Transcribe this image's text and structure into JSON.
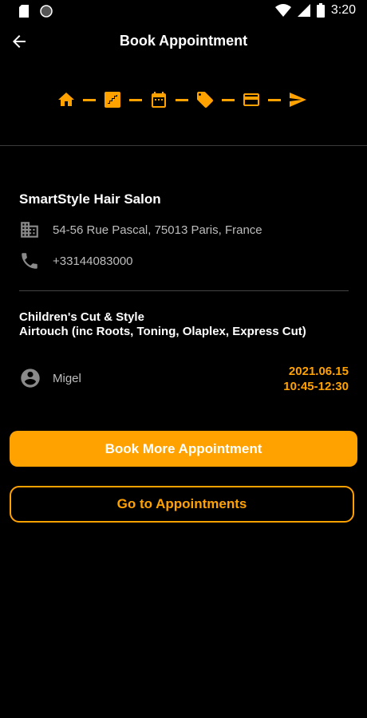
{
  "status_bar": {
    "time": "3:20"
  },
  "header": {
    "title": "Book Appointment"
  },
  "steps": [
    "home-icon",
    "stairs-icon",
    "calendar-icon",
    "tag-icon",
    "credit-card-icon",
    "send-icon"
  ],
  "salon": {
    "name": "SmartStyle Hair Salon",
    "address": "54-56 Rue Pascal, 75013 Paris, France",
    "phone": "+33144083000"
  },
  "services": [
    "Children's Cut & Style",
    "Airtouch (inc Roots, Toning, Olaplex, Express Cut)"
  ],
  "stylist": {
    "name": "Migel"
  },
  "appointment": {
    "date": "2021.06.15",
    "time": "10:45-12:30"
  },
  "buttons": {
    "book_more": "Book More Appointment",
    "go_to": "Go to Appointments"
  },
  "colors": {
    "accent": "#FFA200",
    "background": "#000000"
  }
}
